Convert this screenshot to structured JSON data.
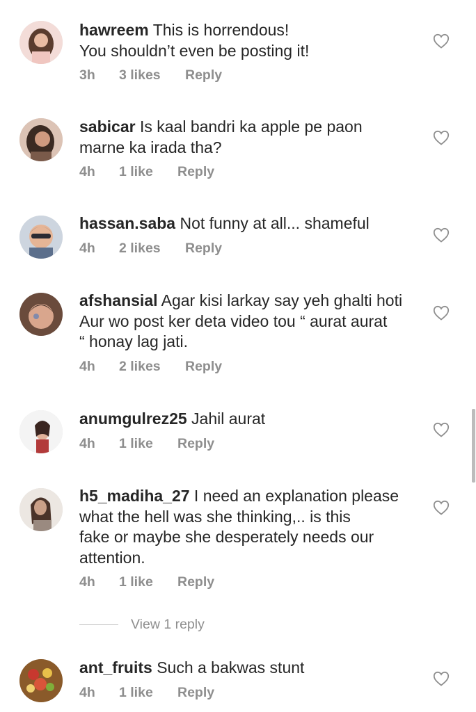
{
  "comments": [
    {
      "username": "hawreem",
      "text": "This is horrendous!",
      "text2": "You shouldn’t even be posting it!",
      "time": "3h",
      "likes": "3 likes",
      "reply": "Reply",
      "avatar_colors": [
        "#f3d9d6",
        "#6b4a3a",
        "#e8b9a0"
      ]
    },
    {
      "username": "sabicar",
      "text": "Is kaal bandri ka apple pe paon",
      "text2": "marne ka irada tha?",
      "time": "4h",
      "likes": "1 like",
      "reply": "Reply",
      "avatar_colors": [
        "#d9b8a7",
        "#3b2a22",
        "#c98f75"
      ]
    },
    {
      "username": "hassan.saba",
      "text": "Not funny at all... shameful",
      "time": "4h",
      "likes": "2 likes",
      "reply": "Reply",
      "avatar_colors": [
        "#cfd6e0",
        "#3a3a44",
        "#e3b395"
      ]
    },
    {
      "username": "afshansial",
      "text": "Agar kisi larkay say yeh ghalti hoti",
      "text2": "Aur wo post ker deta video tou “ aurat aurat",
      "text3": "“ honay lag jati.",
      "time": "4h",
      "likes": "2 likes",
      "reply": "Reply",
      "avatar_colors": [
        "#6a4b3c",
        "#2a1d18",
        "#d9a68d"
      ]
    },
    {
      "username": "anumgulrez25",
      "text": "Jahil aurat",
      "time": "4h",
      "likes": "1 like",
      "reply": "Reply",
      "avatar_colors": [
        "#f2f2f2",
        "#b23a3a",
        "#e1b29a"
      ]
    },
    {
      "username": "h5_madiha_27",
      "text": "I need an explanation please",
      "text2": "what the hell was she thinking,.. is this",
      "text3": "fake or maybe she desperately needs our",
      "text4": "attention.",
      "time": "4h",
      "likes": "1 like",
      "reply": "Reply",
      "avatar_colors": [
        "#ece7e2",
        "#4a3329",
        "#caa088"
      ]
    },
    {
      "username": "ant_fruits",
      "text": "Such a bakwas stunt",
      "time": "4h",
      "likes": "1 like",
      "reply": "Reply",
      "avatar_colors": [
        "#8a5a2a",
        "#c8382f",
        "#e8c04a"
      ]
    }
  ],
  "view_replies": "View 1 reply",
  "icons": {
    "like": "heart-outline-icon"
  },
  "colors": {
    "text": "#262626",
    "meta": "#8e8e8e",
    "heart": "#8e8e8e"
  }
}
